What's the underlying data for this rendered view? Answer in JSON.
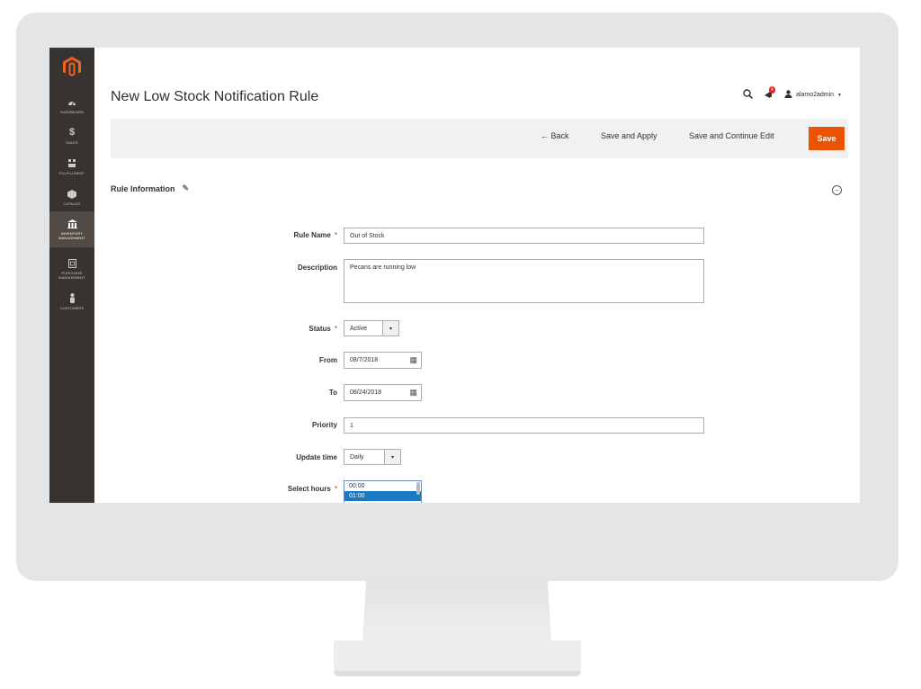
{
  "page": {
    "title": "New Low Stock Notification Rule",
    "notifications_count": "4",
    "user_name": "alamo2admin"
  },
  "sidebar": {
    "items": [
      {
        "label": "DASHBOARD",
        "icon": "dashboard-icon"
      },
      {
        "label": "SALES",
        "icon": "dollar-icon"
      },
      {
        "label": "FULFILLMENT",
        "icon": "boxes-icon"
      },
      {
        "label": "CATALOG",
        "icon": "cube-icon"
      },
      {
        "label": "INVENTORY MANAGEMENT",
        "icon": "warehouse-icon"
      },
      {
        "label": "PURCHASE MANAGEMENT",
        "icon": "clipboard-icon"
      },
      {
        "label": "CUSTOMERS",
        "icon": "person-icon"
      }
    ]
  },
  "toolbar": {
    "back_label": "Back",
    "save_apply_label": "Save and Apply",
    "save_continue_label": "Save and Continue Edit",
    "save_label": "Save"
  },
  "section": {
    "title": "Rule Information"
  },
  "form": {
    "rule_name_label": "Rule Name",
    "rule_name_value": "Out of Stock",
    "description_label": "Description",
    "description_value": "Pecans are running low",
    "status_label": "Status",
    "status_value": "Active",
    "from_label": "From",
    "from_value": "08/7/2018",
    "to_label": "To",
    "to_value": "08/24/2018",
    "priority_label": "Priority",
    "priority_value": "1",
    "update_time_label": "Update time",
    "update_time_value": "Daily",
    "select_hours_label": "Select hours",
    "select_hours_options": [
      "00:00",
      "01:00"
    ]
  }
}
